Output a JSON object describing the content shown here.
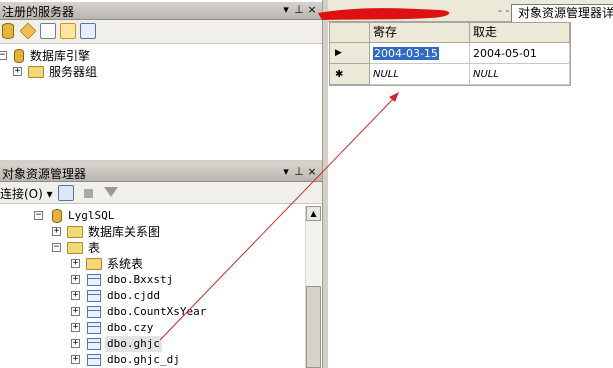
{
  "registered_servers": {
    "title": "注册的服务器",
    "pin_glyph": "⊥",
    "close_glyph": "×",
    "tree": [
      {
        "label": "数据库引擎",
        "icon": "database-engine-icon"
      },
      {
        "label": "服务器组",
        "icon": "folder-icon"
      }
    ]
  },
  "object_explorer": {
    "title": "对象资源管理器",
    "connect_label": "连接(O)",
    "dropdown_glyph": "▾",
    "tree": {
      "database": "LyglSQL",
      "diagrams": "数据库关系图",
      "tables": "表",
      "system_tables": "系统表",
      "items": [
        "dbo.Bxxstj",
        "dbo.cjdd",
        "dbo.CountXsYear",
        "dbo.czy",
        "dbo.ghjc",
        "dbo.ghjc_dj"
      ]
    },
    "selected_item": "dbo.ghjc"
  },
  "document_tab": {
    "label": "对象资源管理器详细",
    "partial_text": "- -"
  },
  "results_grid": {
    "columns": [
      "寄存",
      "取走"
    ],
    "rows": [
      {
        "indicator": "▶",
        "cells": [
          "2004-03-15",
          "2004-05-01"
        ]
      },
      {
        "indicator": "✱",
        "cells": [
          "NULL",
          "NULL"
        ]
      }
    ]
  },
  "colors": {
    "accent_red": "#dd1111",
    "annotation_arrow": "#cc2a2a",
    "selection_blue": "#316ac5"
  }
}
